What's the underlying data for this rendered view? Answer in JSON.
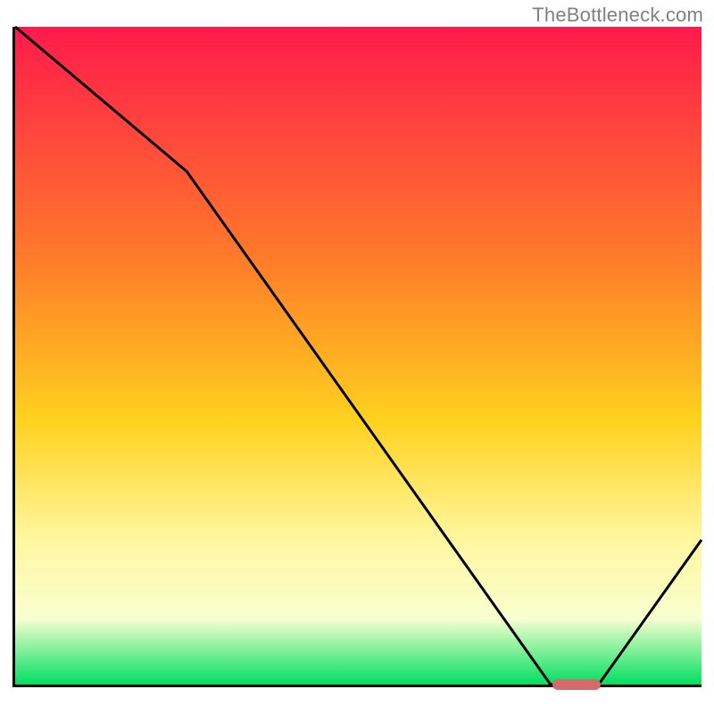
{
  "watermark": "TheBottleneck.com",
  "colors": {
    "gradient_top": "#ff1a4b",
    "gradient_mid_upper": "#ff7a2a",
    "gradient_mid": "#ffd21f",
    "gradient_mid_lower": "#fff7a0",
    "gradient_lower": "#f8ffd0",
    "gradient_bottom": "#00e060",
    "line": "#000000",
    "axis": "#000000",
    "marker": "#d46a6a"
  },
  "chart_data": {
    "type": "line",
    "title": "",
    "xlabel": "",
    "ylabel": "",
    "xlim": [
      0,
      100
    ],
    "ylim": [
      0,
      100
    ],
    "x": [
      0,
      25,
      78,
      85,
      100
    ],
    "values": [
      100,
      78,
      0,
      0,
      22
    ],
    "annotations": [
      {
        "kind": "pill_marker",
        "x_start": 78,
        "x_end": 85,
        "y": 0
      }
    ],
    "background_gradient": [
      {
        "pct": 0,
        "color": "#ff1a4b"
      },
      {
        "pct": 35,
        "color": "#ff7a2a"
      },
      {
        "pct": 60,
        "color": "#ffd21f"
      },
      {
        "pct": 78,
        "color": "#fff7a0"
      },
      {
        "pct": 90,
        "color": "#f8ffd0"
      },
      {
        "pct": 100,
        "color": "#00e060"
      }
    ]
  }
}
